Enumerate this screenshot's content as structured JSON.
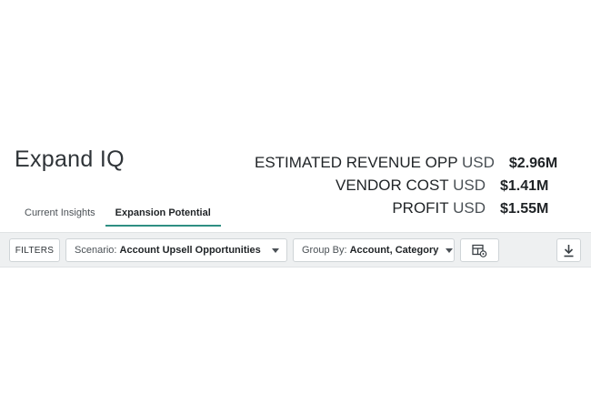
{
  "app": {
    "title": "Expand IQ"
  },
  "metrics": [
    {
      "label": "ESTIMATED REVENUE OPP",
      "unit": "USD",
      "value": "$2.96M"
    },
    {
      "label": "VENDOR COST",
      "unit": "USD",
      "value": "$1.41M"
    },
    {
      "label": "PROFIT",
      "unit": "USD",
      "value": "$1.55M"
    }
  ],
  "tabs": [
    {
      "label": "Current Insights",
      "active": false
    },
    {
      "label": "Expansion Potential",
      "active": true
    }
  ],
  "toolbar": {
    "filters_label": "FILTERS",
    "scenario": {
      "label": "Scenario:",
      "value": "Account Upsell Opportunities",
      "icon": "caret-down-icon"
    },
    "group_by": {
      "label": "Group By:",
      "value": "Account, Category",
      "icon": "caret-down-icon"
    },
    "columns_icon": "table-settings-icon",
    "download_icon": "download-icon"
  },
  "colors": {
    "accent": "#2f8f83",
    "toolbar_bg": "#eef0f1",
    "text": "#1f2326"
  }
}
